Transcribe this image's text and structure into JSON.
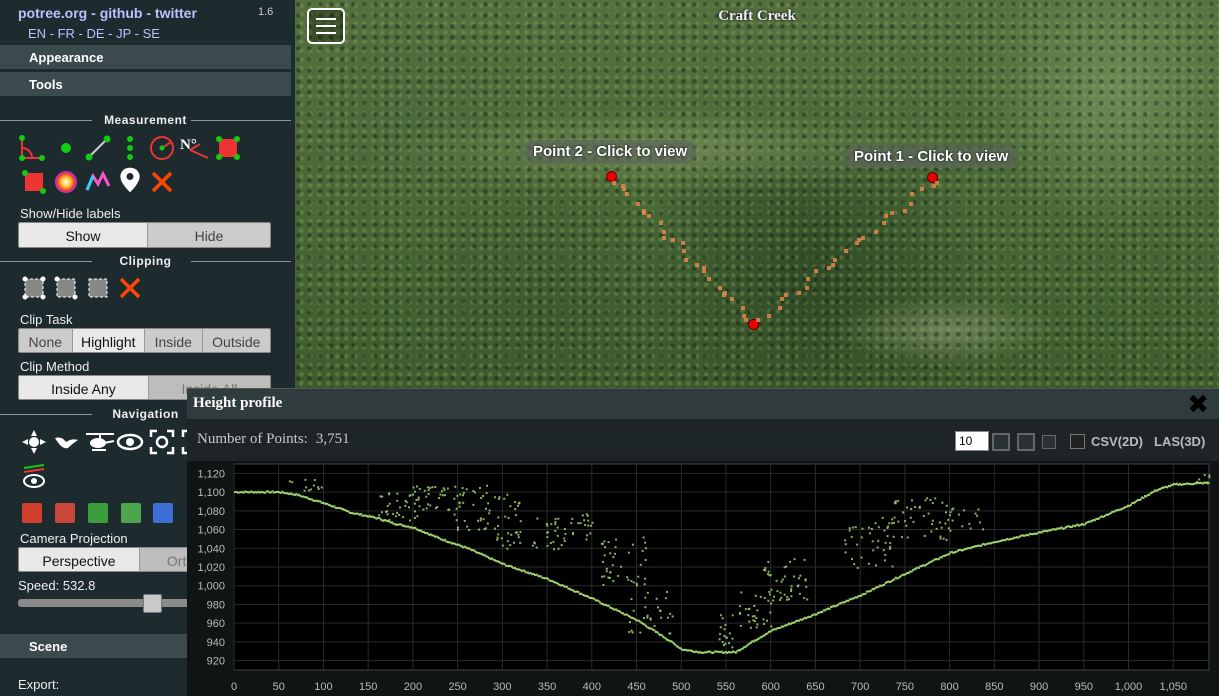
{
  "header": {
    "links": [
      "potree.org",
      "github",
      "twitter"
    ],
    "separator": " - ",
    "version": "1.6",
    "languages": "EN - FR - DE - JP - SE"
  },
  "sections": {
    "appearance": "Appearance",
    "tools": "Tools",
    "measurement": "Measurement",
    "clipping": "Clipping",
    "navigation": "Navigation",
    "scene": "Scene",
    "export": "Export:"
  },
  "measurement": {
    "show_hide_label": "Show/Hide labels",
    "show": "Show",
    "hide": "Hide",
    "north_label": "N°"
  },
  "clipping": {
    "task_label": "Clip Task",
    "tasks": [
      "None",
      "Highlight",
      "Inside",
      "Outside"
    ],
    "method_label": "Clip Method",
    "methods": [
      "Inside Any",
      "Inside All"
    ]
  },
  "navigation": {
    "projection_label": "Camera Projection",
    "projections": [
      "Perspective",
      "Orthographic"
    ],
    "speed_label": "Speed: 532.8",
    "speed_level": 0.72
  },
  "viewer": {
    "title": "Craft Creek",
    "poi_labels": [
      "Point 2 - Click to view",
      "Point 1 - Click to view"
    ]
  },
  "profile": {
    "title": "Height profile",
    "close": "✖",
    "npoints_label": "Number of Points:",
    "npoints": "3,751",
    "point_size": "10",
    "export_csv": "CSV(2D)",
    "export_las": "LAS(3D)"
  },
  "chart_data": {
    "type": "scatter",
    "xlabel": "",
    "ylabel": "",
    "xlim": [
      0,
      1090
    ],
    "ylim": [
      910,
      1130
    ],
    "x_ticks": [
      0,
      50,
      100,
      150,
      200,
      250,
      300,
      350,
      400,
      450,
      500,
      550,
      600,
      650,
      700,
      750,
      800,
      850,
      900,
      950,
      1000,
      1050
    ],
    "x_tick_labels": [
      "0",
      "50",
      "100",
      "150",
      "200",
      "250",
      "300",
      "350",
      "400",
      "450",
      "500",
      "550",
      "600",
      "650",
      "700",
      "750",
      "800",
      "850",
      "900",
      "950",
      "1,000",
      "1,050"
    ],
    "y_ticks": [
      920,
      940,
      960,
      980,
      1000,
      1020,
      1040,
      1060,
      1080,
      1100,
      1120
    ],
    "y_tick_labels": [
      "920",
      "940",
      "960",
      "980",
      "1,000",
      "1,020",
      "1,040",
      "1,060",
      "1,080",
      "1,100",
      "1,120"
    ],
    "grid": true,
    "ground_profile": [
      [
        0,
        1100
      ],
      [
        50,
        1100
      ],
      [
        70,
        1097
      ],
      [
        100,
        1088
      ],
      [
        130,
        1078
      ],
      [
        160,
        1072
      ],
      [
        180,
        1066
      ],
      [
        200,
        1062
      ],
      [
        230,
        1050
      ],
      [
        260,
        1040
      ],
      [
        300,
        1023
      ],
      [
        350,
        1007
      ],
      [
        400,
        986
      ],
      [
        450,
        963
      ],
      [
        480,
        945
      ],
      [
        500,
        932
      ],
      [
        520,
        929
      ],
      [
        560,
        929
      ],
      [
        580,
        941
      ],
      [
        600,
        952
      ],
      [
        650,
        970
      ],
      [
        700,
        990
      ],
      [
        750,
        1013
      ],
      [
        800,
        1035
      ],
      [
        850,
        1047
      ],
      [
        900,
        1057
      ],
      [
        950,
        1066
      ],
      [
        1000,
        1086
      ],
      [
        1030,
        1102
      ],
      [
        1050,
        1108
      ],
      [
        1090,
        1110
      ]
    ],
    "vegetation_clusters": [
      {
        "x": [
          60,
          100
        ],
        "y": [
          1100,
          1115
        ],
        "n": 12
      },
      {
        "x": [
          160,
          205
        ],
        "y": [
          1070,
          1100
        ],
        "n": 30
      },
      {
        "x": [
          195,
          240
        ],
        "y": [
          1082,
          1108
        ],
        "n": 35
      },
      {
        "x": [
          245,
          285
        ],
        "y": [
          1060,
          1110
        ],
        "n": 40
      },
      {
        "x": [
          290,
          320
        ],
        "y": [
          1040,
          1105
        ],
        "n": 35
      },
      {
        "x": [
          330,
          370
        ],
        "y": [
          1040,
          1075
        ],
        "n": 28
      },
      {
        "x": [
          375,
          400
        ],
        "y": [
          1050,
          1078
        ],
        "n": 18
      },
      {
        "x": [
          410,
          460
        ],
        "y": [
          1000,
          1055
        ],
        "n": 40
      },
      {
        "x": [
          440,
          490
        ],
        "y": [
          950,
          1005
        ],
        "n": 30
      },
      {
        "x": [
          540,
          560
        ],
        "y": [
          930,
          970
        ],
        "n": 18
      },
      {
        "x": [
          560,
          600
        ],
        "y": [
          950,
          1000
        ],
        "n": 30
      },
      {
        "x": [
          590,
          640
        ],
        "y": [
          985,
          1030
        ],
        "n": 45
      },
      {
        "x": [
          680,
          740
        ],
        "y": [
          1020,
          1075
        ],
        "n": 40
      },
      {
        "x": [
          730,
          800
        ],
        "y": [
          1050,
          1095
        ],
        "n": 45
      },
      {
        "x": [
          790,
          840
        ],
        "y": [
          1060,
          1085
        ],
        "n": 18
      },
      {
        "x": [
          1075,
          1090
        ],
        "y": [
          1110,
          1120
        ],
        "n": 6
      }
    ],
    "point_color": "#9fd36f"
  }
}
